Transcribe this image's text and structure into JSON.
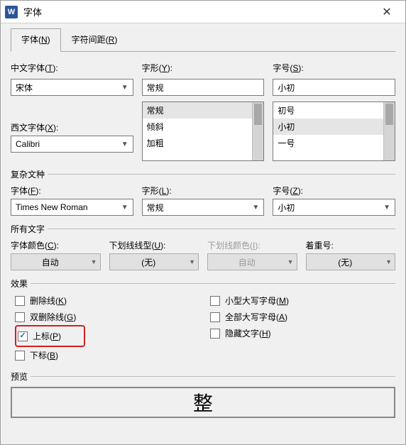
{
  "window": {
    "app_icon_letter": "W",
    "title": "字体",
    "close_glyph": "✕"
  },
  "tabs": {
    "font_label_pre": "字体(",
    "font_key": "N",
    "spacing_label_pre": "字符间距(",
    "spacing_key": "R",
    "close_paren": ")"
  },
  "labels": {
    "cn_font_pre": "中文字体(",
    "cn_font_key": "T",
    "style_pre": "字形(",
    "style_key": "Y",
    "size_pre": "字号(",
    "size_key": "S",
    "west_font_pre": "西文字体(",
    "west_font_key": "X",
    "complex_legend": "复杂文种",
    "cfont_pre": "字体(",
    "cfont_key": "F",
    "cstyle_pre": "字形(",
    "cstyle_key": "L",
    "csize_pre": "字号(",
    "csize_key": "Z",
    "alltext_legend": "所有文字",
    "color_pre": "字体颜色(",
    "color_key": "C",
    "underline_pre": "下划线线型(",
    "underline_key": "U",
    "ulcolor_pre": "下划线颜色(",
    "ulcolor_key": "I",
    "emph_pre": "着重号",
    "effects_legend": "效果",
    "preview_legend": "预览",
    "close_paren": ")",
    "colon": ":"
  },
  "values": {
    "cn_font": "宋体",
    "style": "常规",
    "size": "小初",
    "west_font": "Calibri",
    "cfont": "Times New Roman",
    "cstyle": "常规",
    "csize": "小初",
    "color_auto": "自动",
    "underline_none": "(无)",
    "ulcolor_auto": "自动",
    "emph_none": "(无)",
    "preview_text": "整"
  },
  "style_list": [
    "常规",
    "倾斜",
    "加粗"
  ],
  "size_list": [
    "初号",
    "小初",
    "一号"
  ],
  "effects": {
    "strike_pre": "删除线(",
    "strike_key": "K",
    "dstrike_pre": "双删除线(",
    "dstrike_key": "G",
    "super_pre": "上标(",
    "super_key": "P",
    "sub_pre": "下标(",
    "sub_key": "B",
    "smallcaps_pre": "小型大写字母(",
    "smallcaps_key": "M",
    "allcaps_pre": "全部大写字母(",
    "allcaps_key": "A",
    "hidden_pre": "隐藏文字(",
    "hidden_key": "H",
    "close_paren": ")"
  }
}
